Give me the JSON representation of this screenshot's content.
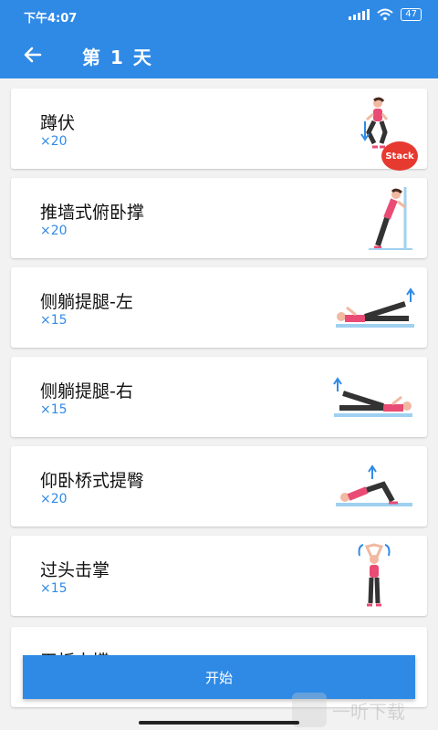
{
  "status": {
    "time": "下午4:07",
    "battery": "47"
  },
  "appbar": {
    "title": "第 1 天"
  },
  "exercises": [
    {
      "name": "蹲伏",
      "reps": "×20"
    },
    {
      "name": "推墙式俯卧撑",
      "reps": "×20"
    },
    {
      "name": "侧躺提腿-左",
      "reps": "×15"
    },
    {
      "name": "侧躺提腿-右",
      "reps": "×15"
    },
    {
      "name": "仰卧桥式提臀",
      "reps": "×20"
    },
    {
      "name": "过头击掌",
      "reps": "×15"
    },
    {
      "name": "平板支撑",
      "reps": ""
    }
  ],
  "badge": {
    "label": "Stack"
  },
  "start_button": {
    "label": "开始"
  },
  "watermark": {
    "text": "一听下载"
  },
  "colors": {
    "primary": "#2f8ae6",
    "badge": "#e6392f",
    "skin": "#f1b9a1",
    "top": "#e94b74",
    "pants": "#333333"
  }
}
